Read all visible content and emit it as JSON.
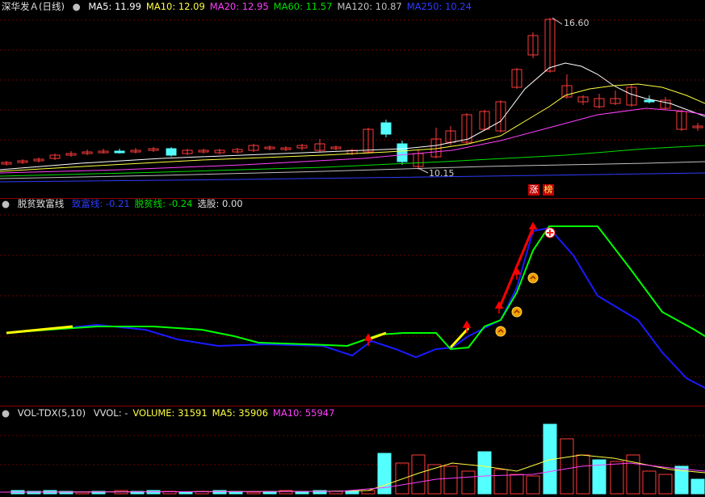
{
  "colors": {
    "bg": "#000000",
    "grid": "#6b0000",
    "up": "#ff3a3a",
    "down": "#54ffff",
    "ma5": "#ffffff",
    "ma10": "#ffff40",
    "ma20": "#ff40ff",
    "ma60": "#00e000",
    "ma120": "#c0c0c0",
    "ma250": "#2f3cff",
    "green": "#00ff00",
    "blue": "#1a1aff",
    "yellow": "#ffff00",
    "red": "#ff0000"
  },
  "main": {
    "title": "深华发Ａ(日线)",
    "indicators": [
      {
        "label": "MA5: 11.99",
        "color": "#ffffff"
      },
      {
        "label": "MA10: 12.09",
        "color": "#ffff40"
      },
      {
        "label": "MA20: 12.95",
        "color": "#ff40ff"
      },
      {
        "label": "MA60: 11.57",
        "color": "#00e000"
      },
      {
        "label": "MA120: 10.87",
        "color": "#c0c0c0"
      },
      {
        "label": "MA250: 10.24",
        "color": "#2f3cff"
      }
    ],
    "high_label": "16.60",
    "low_label": "10.15",
    "badges": [
      "涨",
      "榜"
    ]
  },
  "osc": {
    "title": "脱贫致富线",
    "items": [
      {
        "label": "致富线: -0.21",
        "color": "#2f3cff"
      },
      {
        "label": "脱贫线: -0.24",
        "color": "#00e000"
      },
      {
        "label": "选股: 0.00",
        "color": "#e0e0e0"
      }
    ]
  },
  "vol": {
    "title": "VOL-TDX(5,10)",
    "items": [
      {
        "label": "VVOL: -",
        "color": "#e0e0e0"
      },
      {
        "label": "VOLUME: 31591",
        "color": "#ffff40"
      },
      {
        "label": "MA5: 35906",
        "color": "#ffff40"
      },
      {
        "label": "MA10: 55947",
        "color": "#ff40ff"
      }
    ]
  }
}
